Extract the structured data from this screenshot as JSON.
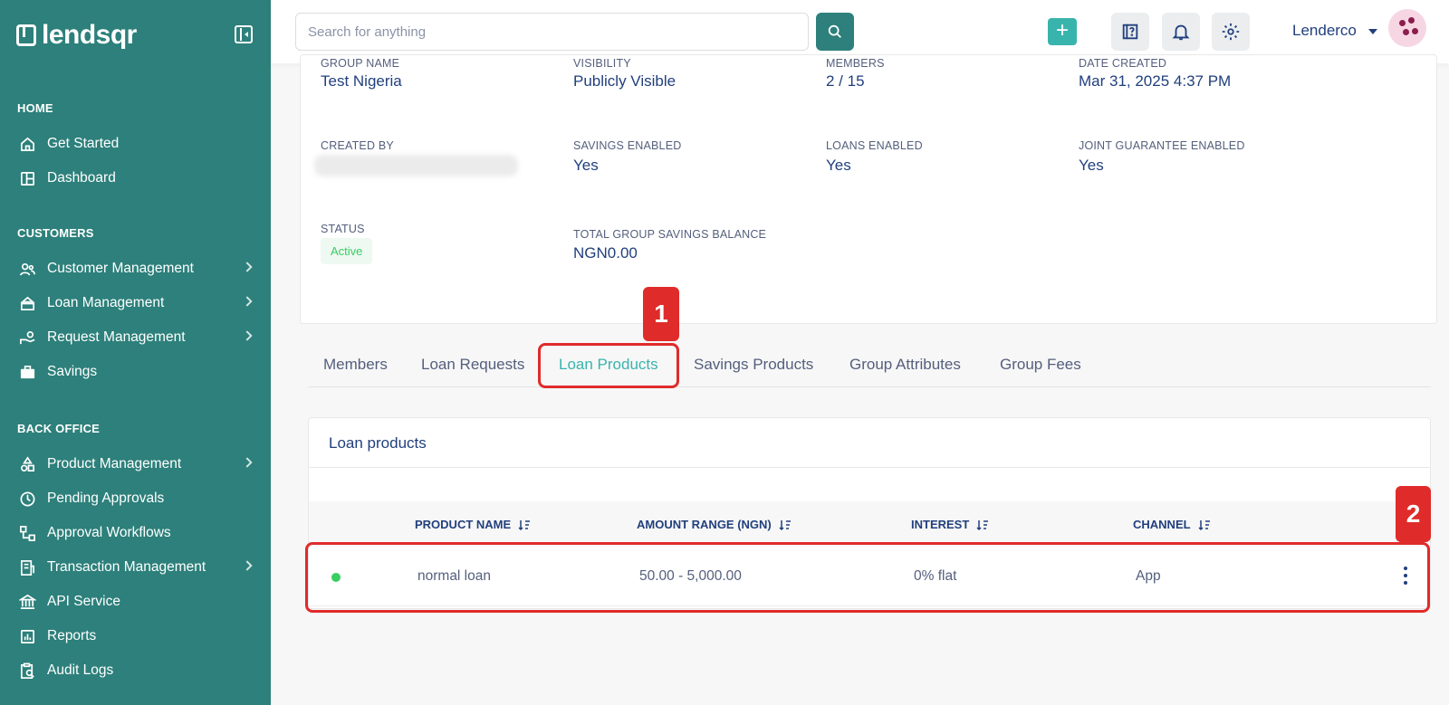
{
  "sidebar": {
    "brand": "lendsqr",
    "sections": {
      "home": "HOME",
      "customers": "CUSTOMERS",
      "back_office": "BACK OFFICE"
    },
    "items": {
      "get_started": "Get Started",
      "dashboard": "Dashboard",
      "customer_management": "Customer Management",
      "loan_management": "Loan Management",
      "request_management": "Request Management",
      "savings": "Savings",
      "product_management": "Product Management",
      "pending_approvals": "Pending Approvals",
      "approval_workflows": "Approval Workflows",
      "transaction_management": "Transaction Management",
      "api_service": "API Service",
      "reports": "Reports",
      "audit_logs": "Audit Logs"
    }
  },
  "topbar": {
    "search_placeholder": "Search for anything",
    "user_name": "Lenderco",
    "accent": "#39b4ad"
  },
  "group": {
    "group_name_label": "GROUP NAME",
    "group_name": "Test Nigeria",
    "visibility_label": "VISIBILITY",
    "visibility": "Publicly Visible",
    "members_label": "MEMBERS",
    "members": "2 / 15",
    "date_created_label": "DATE CREATED",
    "date_created": "Mar 31, 2025 4:37 PM",
    "created_by_label": "CREATED BY",
    "savings_enabled_label": "SAVINGS ENABLED",
    "savings_enabled": "Yes",
    "loans_enabled_label": "LOANS ENABLED",
    "loans_enabled": "Yes",
    "joint_guarantee_label": "JOINT GUARANTEE ENABLED",
    "joint_guarantee": "Yes",
    "status_label": "STATUS",
    "status": "Active",
    "total_savings_label": "TOTAL GROUP SAVINGS BALANCE",
    "total_savings": "NGN0.00"
  },
  "tabs": {
    "members": "Members",
    "loan_requests": "Loan Requests",
    "loan_products": "Loan Products",
    "savings_products": "Savings Products",
    "group_attributes": "Group Attributes",
    "group_fees": "Group Fees",
    "active": "Loan Products"
  },
  "loan_products": {
    "title": "Loan products",
    "columns": {
      "product_name": "PRODUCT NAME",
      "amount_range": "AMOUNT RANGE (NGN)",
      "interest": "INTEREST",
      "channel": "CHANNEL"
    },
    "rows": [
      {
        "product_name": "normal loan",
        "amount_range": "50.00 - 5,000.00",
        "interest": "0% flat",
        "channel": "App",
        "status_color": "#39cd62"
      }
    ]
  },
  "annotations": {
    "marker_1": "1",
    "marker_2": "2",
    "color": "#e02b2b"
  }
}
